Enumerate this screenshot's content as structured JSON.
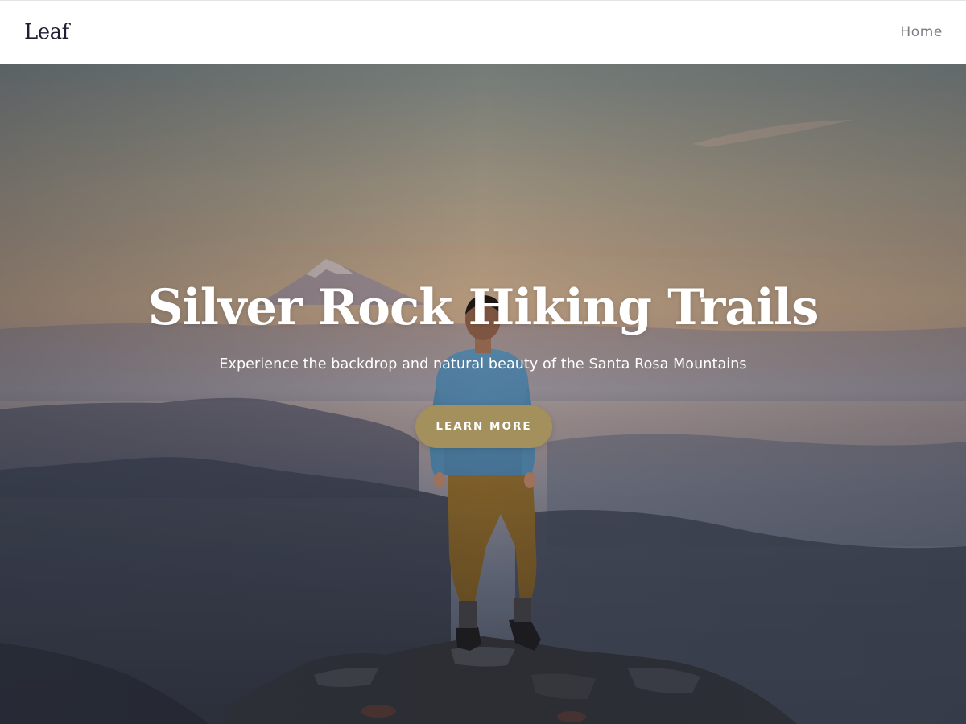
{
  "header": {
    "logo_text": "Leaf",
    "nav": {
      "home_label": "Home"
    }
  },
  "hero": {
    "title": "Silver Rock Hiking Trails",
    "subtitle": "Experience the backdrop and natural beauty of the Santa Rosa Mountains",
    "cta_label": "LEARN MORE"
  },
  "colors": {
    "header_background": "#ffffff",
    "logo_text": "#1f1f33",
    "nav_text": "#7c7d84",
    "cta_background": "#a3905d",
    "hero_text": "#ffffff"
  }
}
